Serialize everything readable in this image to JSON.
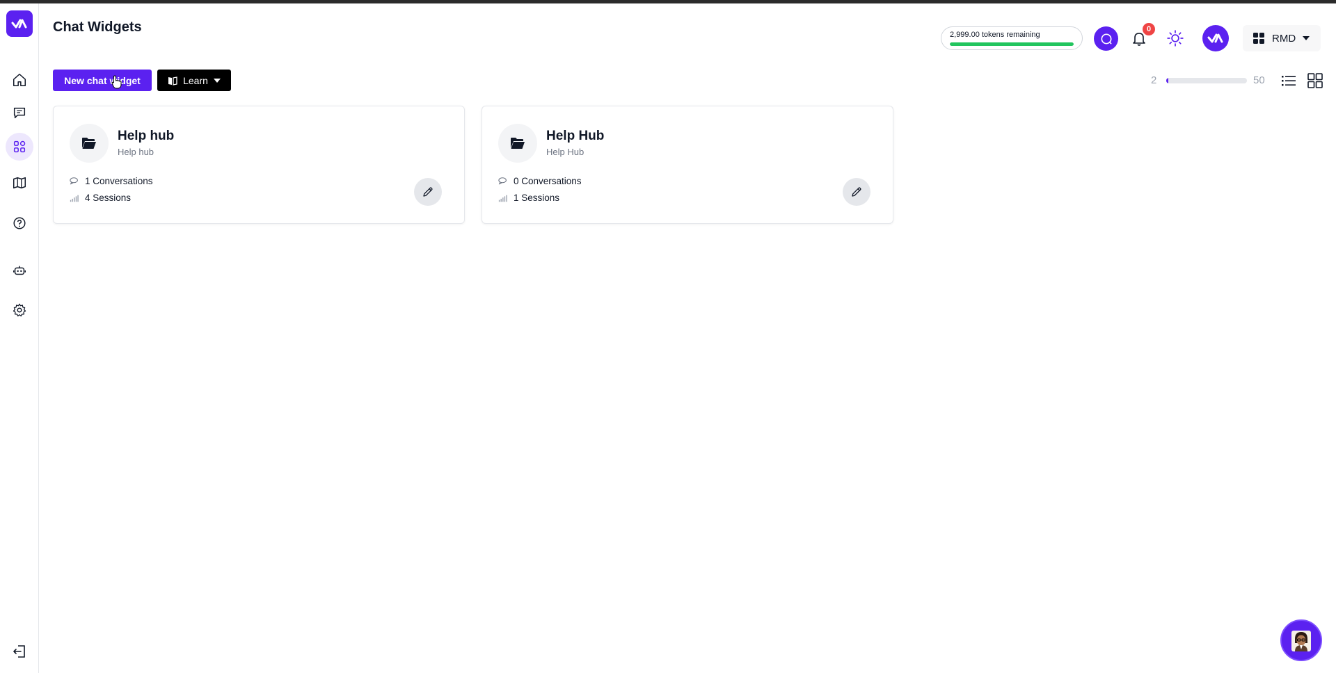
{
  "header": {
    "title": "Chat Widgets",
    "tokens_label": "2,999.00 tokens remaining",
    "tokens_fraction": 1.0,
    "notification_count": "0",
    "org_label": "RMD"
  },
  "sidebar": {
    "items": [
      {
        "name": "home",
        "icon": "home-icon"
      },
      {
        "name": "conversations",
        "icon": "chat-icon"
      },
      {
        "name": "widgets",
        "icon": "widgets-icon",
        "active": true
      },
      {
        "name": "knowledge",
        "icon": "book-icon"
      },
      {
        "name": "help",
        "icon": "help-icon"
      },
      {
        "name": "bots",
        "icon": "robot-icon"
      },
      {
        "name": "settings",
        "icon": "gear-icon"
      }
    ],
    "logout_icon": "logout-icon"
  },
  "toolbar": {
    "new_label": "New chat widget",
    "learn_label": "Learn",
    "range_min": "2",
    "range_max": "50",
    "range_fraction": 0.02
  },
  "cards": [
    {
      "title": "Help hub",
      "subtitle": "Help hub",
      "conversations": "1 Conversations",
      "sessions": "4 Sessions"
    },
    {
      "title": "Help Hub",
      "subtitle": "Help Hub",
      "conversations": "0 Conversations",
      "sessions": "1 Sessions"
    }
  ],
  "colors": {
    "accent": "#5b21f0",
    "tokens_bar": "#22c55e",
    "badge": "#ef4444"
  }
}
